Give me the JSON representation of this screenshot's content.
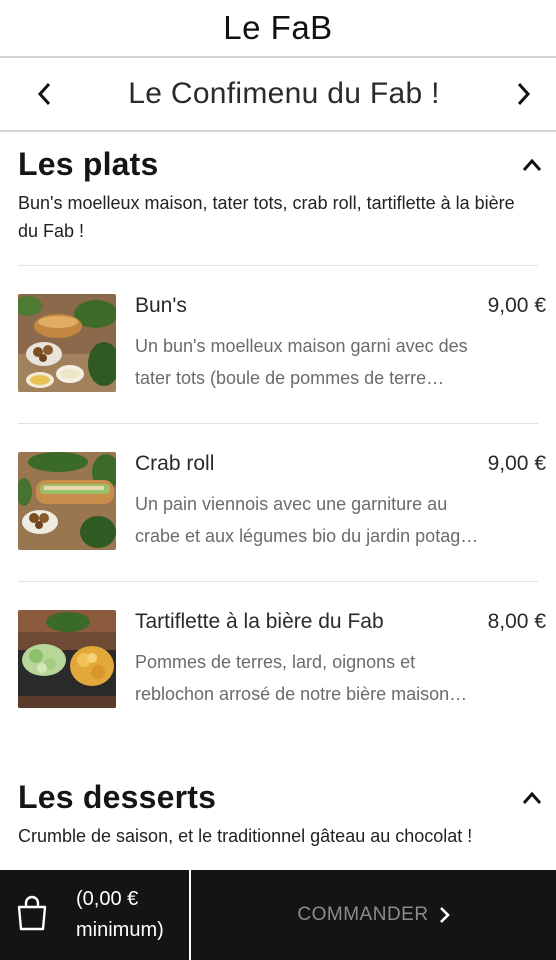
{
  "app": {
    "title": "Le FaB"
  },
  "menu_nav": {
    "name": "Le Confimenu du Fab !",
    "prev_icon": "chevron-left-icon",
    "next_icon": "chevron-right-icon"
  },
  "sections": [
    {
      "title": "Les plats",
      "description": "Bun's moelleux maison, tater tots, crab roll, tartiflette à la bière du Fab !",
      "items": [
        {
          "name": "Bun's",
          "price": "9,00 €",
          "desc_line1": "Un bun's moelleux maison garni avec des",
          "desc_line2": "tater tots (boule de pommes de terre…"
        },
        {
          "name": "Crab roll",
          "price": "9,00 €",
          "desc_line1": "Un pain viennois avec une garniture au",
          "desc_line2": "crabe et aux légumes bio du jardin potag…"
        },
        {
          "name": "Tartiflette à la bière du Fab",
          "price": "8,00 €",
          "desc_line1": "Pommes de terres, lard, oignons et",
          "desc_line2": "reblochon arrosé de notre bière maison…"
        }
      ]
    },
    {
      "title": "Les desserts",
      "description": "Crumble de saison, et le traditionnel gâteau au chocolat !"
    }
  ],
  "footer": {
    "cart_line1": "(0,00 €",
    "cart_line2": "minimum)",
    "order_label": "COMMANDER",
    "bag_icon": "shopping-bag-icon"
  },
  "colors": {
    "footer_bg": "#141414",
    "order_text": "#8c8c8c",
    "divider": "#e2e2e2"
  }
}
